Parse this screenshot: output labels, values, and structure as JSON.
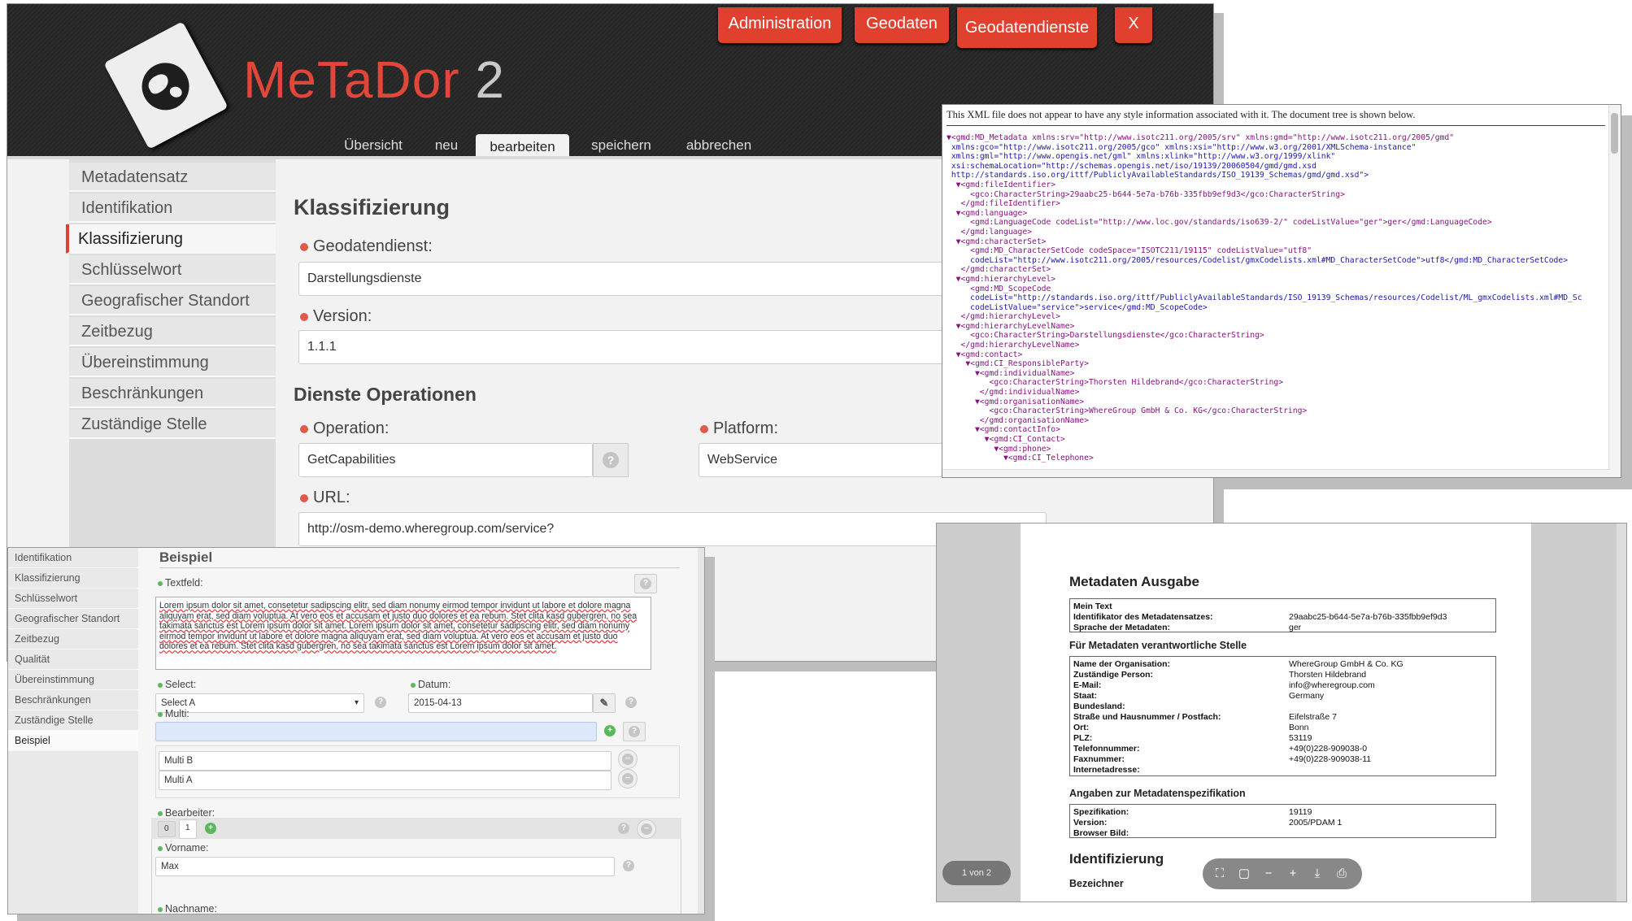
{
  "main": {
    "logo": {
      "part_a": "MeTaDor",
      "part_b": "2"
    },
    "top_nav": [
      "Administration",
      "Geodaten",
      "Geodatendienste",
      "X"
    ],
    "sub_nav": [
      "Übersicht",
      "neu",
      "bearbeiten",
      "speichern",
      "abbrechen"
    ],
    "sidebar": [
      "Metadatensatz",
      "Identifikation",
      "Klassifizierung",
      "Schlüsselwort",
      "Geografischer Standort",
      "Zeitbezug",
      "Übereinstimmung",
      "Beschränkungen",
      "Zuständige Stelle"
    ],
    "title": "Klassifizierung",
    "geodatendienst_label": "Geodatendienst:",
    "geodatendienst_value": "Darstellungsdienste",
    "version_label": "Version:",
    "version_value": "1.1.1",
    "ops_title": "Dienste Operationen",
    "operation_label": "Operation:",
    "operation_value": "GetCapabilities",
    "platform_label": "Platform:",
    "platform_value": "WebService",
    "url_label": "URL:",
    "url_value": "http://osm-demo.wheregroup.com/service?",
    "help": "?"
  },
  "xml": {
    "note": "This XML file does not appear to have any style information associated with it. The document tree is shown below.",
    "lines": [
      "▼<gmd:MD_Metadata xmlns:srv=\"http://www.isotc211.org/2005/srv\" xmlns:gmd=\"http://www.isotc211.org/2005/gmd\"",
      " xmlns:gco=\"http://www.isotc211.org/2005/gco\" xmlns:xsi=\"http://www.w3.org/2001/XMLSchema-instance\"",
      " xmlns:gml=\"http://www.opengis.net/gml\" xmlns:xlink=\"http://www.w3.org/1999/xlink\"",
      " xsi:schemaLocation=\"http://schemas.opengis.net/iso/19139/20060504/gmd/gmd.xsd",
      " http://standards.iso.org/ittf/PubliclyAvailableStandards/ISO_19139_Schemas/gmd/gmd.xsd\">",
      "  ▼<gmd:fileIdentifier>",
      "     <gco:CharacterString>29aabc25-b644-5e7a-b76b-335fbb9ef9d3</gco:CharacterString>",
      "   </gmd:fileIdentifier>",
      "  ▼<gmd:language>",
      "     <gmd:LanguageCode codeList=\"http://www.loc.gov/standards/iso639-2/\" codeListValue=\"ger\">ger</gmd:LanguageCode>",
      "   </gmd:language>",
      "  ▼<gmd:characterSet>",
      "     <gmd:MD_CharacterSetCode codeSpace=\"ISOTC211/19115\" codeListValue=\"utf8\"",
      "     codeList=\"http://www.isotc211.org/2005/resources/Codelist/gmxCodelists.xml#MD_CharacterSetCode\">utf8</gmd:MD_CharacterSetCode>",
      "   </gmd:characterSet>",
      "  ▼<gmd:hierarchyLevel>",
      "     <gmd:MD_ScopeCode",
      "     codeList=\"http://standards.iso.org/ittf/PubliclyAvailableStandards/ISO_19139_Schemas/resources/Codelist/ML_gmxCodelists.xml#MD_Sc",
      "     codeListValue=\"service\">service</gmd:MD_ScopeCode>",
      "   </gmd:hierarchyLevel>",
      "  ▼<gmd:hierarchyLevelName>",
      "     <gco:CharacterString>Darstellungsdienste</gco:CharacterString>",
      "   </gmd:hierarchyLevelName>",
      "  ▼<gmd:contact>",
      "    ▼<gmd:CI_ResponsibleParty>",
      "      ▼<gmd:individualName>",
      "         <gco:CharacterString>Thorsten Hildebrand</gco:CharacterString>",
      "       </gmd:individualName>",
      "      ▼<gmd:organisationName>",
      "         <gco:CharacterString>WhereGroup GmbH & Co. KG</gco:CharacterString>",
      "       </gmd:organisationName>",
      "      ▼<gmd:contactInfo>",
      "        ▼<gmd:CI_Contact>",
      "          ▼<gmd:phone>",
      "            ▼<gmd:CI_Telephone>"
    ]
  },
  "example": {
    "sidebar": [
      "Identifikation",
      "Klassifizierung",
      "Schlüsselwort",
      "Geografischer Standort",
      "Zeitbezug",
      "Qualität",
      "Übereinstimmung",
      "Beschränkungen",
      "Zuständige Stelle",
      "Beispiel"
    ],
    "title": "Beispiel",
    "textfeld_label": "Textfeld:",
    "textfeld_value": "Lorem ipsum dolor sit amet, consetetur sadipscing elitr, sed diam nonumy eirmod tempor invidunt ut labore et dolore magna aliquyam erat, sed diam voluptua. At vero eos et accusam et justo duo dolores et ea rebum. Stet clita kasd gubergren, no sea takimata sanctus est Lorem ipsum dolor sit amet. Lorem ipsum dolor sit amet, consetetur sadipscing elitr, sed diam nonumy eirmod tempor invidunt ut labore et dolore magna aliquyam erat, sed diam voluptua. At vero eos et accusam et justo duo dolores et ea rebum. Stet clita kasd gubergren, no sea takimata sanctus est Lorem ipsum dolor sit amet.",
    "select_label": "Select:",
    "select_value": "Select A",
    "datum_label": "Datum:",
    "datum_value": "2015-04-13",
    "multi_label": "Multi:",
    "multi_b": "Multi B",
    "multi_a": "Multi A",
    "bearbeiter_label": "Bearbeiter:",
    "tab_0": "0",
    "tab_1": "1",
    "vorname_label": "Vorname:",
    "vorname_value": "Max",
    "nachname_label": "Nachname:",
    "help": "?",
    "add": "+",
    "remove": "−",
    "caret": "▾"
  },
  "pdf": {
    "title": "Metadaten Ausgabe",
    "section1_rows": [
      [
        "Mein Text",
        ""
      ],
      [
        "Identifikator des Metadatensatzes:",
        "29aabc25-b644-5e7a-b76b-335fbb9ef9d3"
      ],
      [
        "Sprache der Metadaten:",
        "ger"
      ]
    ],
    "section2_title": "Für Metadaten verantwortliche Stelle",
    "section2_rows": [
      [
        "Name der Organisation:",
        "WhereGroup GmbH & Co. KG"
      ],
      [
        "Zuständige Person:",
        "Thorsten Hildebrand"
      ],
      [
        "E-Mail:",
        "info@wheregroup.com"
      ],
      [
        "Staat:",
        "Germany"
      ],
      [
        "Bundesland:",
        ""
      ],
      [
        "Straße und Hausnummer / Postfach:",
        "Eifelstraße 7"
      ],
      [
        "Ort:",
        "Bonn"
      ],
      [
        "PLZ:",
        "53119"
      ],
      [
        "Telefonnummer:",
        "+49(0)228-909038-0"
      ],
      [
        "Faxnummer:",
        "+49(0)228-909038-11"
      ],
      [
        "Internetadresse:",
        ""
      ]
    ],
    "section3_title": "Angaben zur Metadatenspezifikation",
    "section3_rows": [
      [
        "Spezifikation:",
        "19119"
      ],
      [
        "Version:",
        "2005/PDAM 1"
      ],
      [
        "Browser Bild:",
        ""
      ]
    ],
    "section4_title": "Identifizierung",
    "section4_sub": "Bezeichner",
    "page_indicator": "1 von 2",
    "tools": [
      "⛶",
      "▢",
      "−",
      "+",
      "⤓",
      "⎙"
    ]
  },
  "colors": {
    "accent": "#e2402f",
    "header_bg": "#2a2a2a",
    "required_dot": "#e05a4c",
    "ok_dot": "#5cb85c"
  }
}
